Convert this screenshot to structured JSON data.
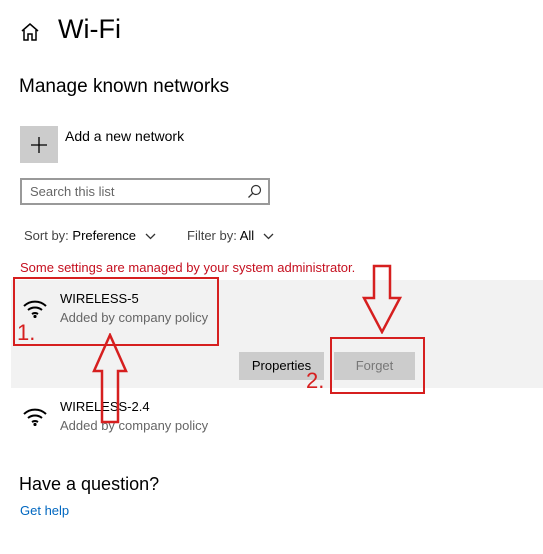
{
  "header": {
    "title": "Wi-Fi",
    "home_icon": "home-icon"
  },
  "section": {
    "title": "Manage known networks"
  },
  "add_network": {
    "label": "Add a new network",
    "icon": "plus-icon"
  },
  "search": {
    "placeholder": "Search this list",
    "value": "",
    "icon": "search-icon"
  },
  "sort": {
    "label": "Sort by:",
    "value": "Preference"
  },
  "filter": {
    "label": "Filter by:",
    "value": "All"
  },
  "admin_warning": "Some settings are managed by your system administrator.",
  "networks": [
    {
      "name": "WIRELESS-5",
      "status": "Added by company policy",
      "selected": true
    },
    {
      "name": "WIRELESS-2.4",
      "status": "Added by company policy",
      "selected": false
    }
  ],
  "actions": {
    "properties": "Properties",
    "forget": "Forget",
    "forget_disabled": true
  },
  "help": {
    "title": "Have a question?",
    "link": "Get help"
  },
  "annotations": {
    "step1": "1.",
    "step2": "2.",
    "color": "#d61f1f"
  },
  "colors": {
    "accent": "#0067c0",
    "warning": "#c50f1f",
    "selected_bg": "#f2f2f2",
    "button_bg": "#cccccc"
  }
}
